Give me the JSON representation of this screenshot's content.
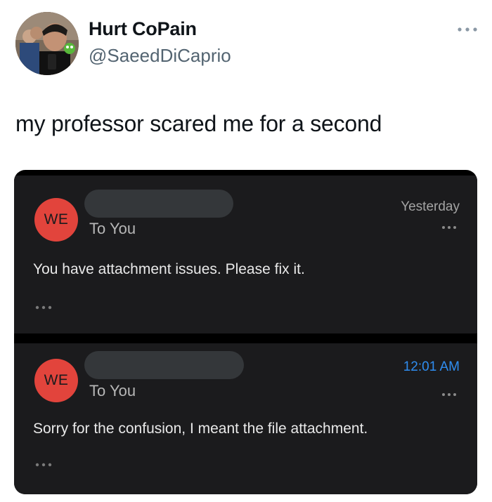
{
  "tweet": {
    "display_name": "Hurt CoPain",
    "handle": "@SaeedDiCaprio",
    "text": "my professor scared me for a second",
    "more_icon": "ellipsis-icon"
  },
  "emails": [
    {
      "avatar_initials": "WE",
      "to_label": "To You",
      "timestamp": "Yesterday",
      "body": "You have attachment issues. Please fix it."
    },
    {
      "avatar_initials": "WE",
      "to_label": "To You",
      "timestamp": "12:01 AM",
      "body": "Sorry for the confusion, I meant the file attachment."
    }
  ],
  "colors": {
    "avatar_red": "#e2443c",
    "card_bg": "#1b1b1d",
    "timestamp_blue": "#2f8df0",
    "handle_gray": "#536471"
  }
}
